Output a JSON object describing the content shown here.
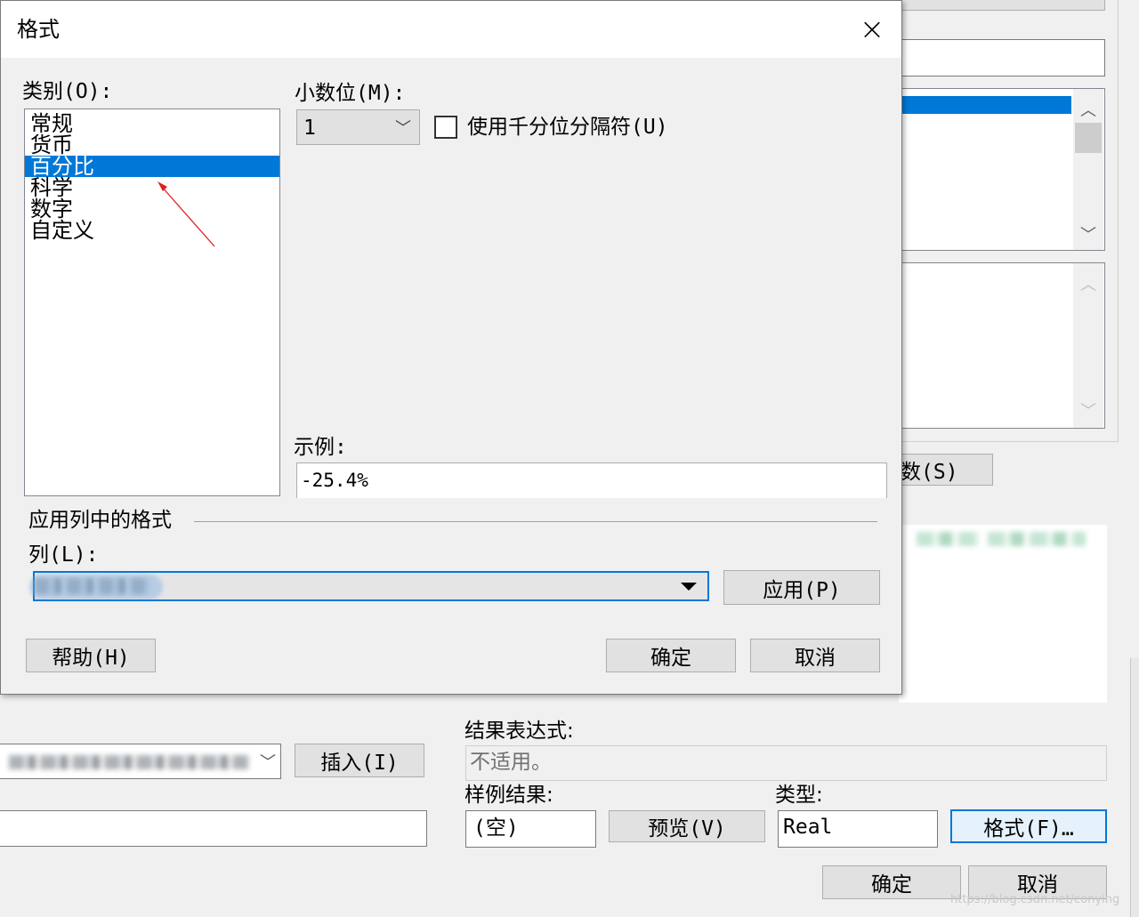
{
  "dialog": {
    "title": "格式",
    "close_icon": "×",
    "category_label": "类别(O):",
    "categories": [
      "常规",
      "货币",
      "百分比",
      "科学",
      "数字",
      "自定义"
    ],
    "selected_category": "百分比",
    "decimals_label": "小数位(M):",
    "decimals_value": "1",
    "thousands_label": "使用千分位分隔符(U)",
    "sample_label": "示例:",
    "sample_value": "-25.4%",
    "apply_group_label": "应用列中的格式",
    "column_label": "列(L):",
    "apply_button": "应用(P)",
    "help_button": "帮助(H)",
    "ok_button": "确定",
    "cancel_button": "取消"
  },
  "background": {
    "button_partial": "数(S)",
    "insert_button": "插入(I)",
    "result_expr_label": "结果表达式:",
    "result_expr_value": "不适用。",
    "sample_result_label": "样例结果:",
    "sample_result_value": "(空)",
    "preview_button": "预览(V)",
    "type_label": "类型:",
    "type_value": "Real",
    "format_button": "格式(F)…",
    "ok_button": "确定",
    "cancel_button": "取消",
    "watermark": "https://blog.csdn.net/conying"
  },
  "colors": {
    "selection": "#0078d7",
    "focus_border": "#0078d7",
    "annotation_arrow": "#e02020"
  }
}
